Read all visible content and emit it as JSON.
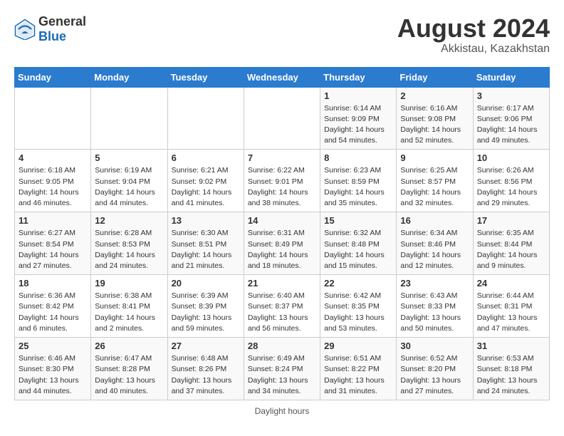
{
  "header": {
    "logo_general": "General",
    "logo_blue": "Blue",
    "month_year": "August 2024",
    "location": "Akkistau, Kazakhstan"
  },
  "days_of_week": [
    "Sunday",
    "Monday",
    "Tuesday",
    "Wednesday",
    "Thursday",
    "Friday",
    "Saturday"
  ],
  "footer": {
    "note": "Daylight hours"
  },
  "weeks": [
    {
      "days": [
        {
          "num": "",
          "sunrise": "",
          "sunset": "",
          "daylight": ""
        },
        {
          "num": "",
          "sunrise": "",
          "sunset": "",
          "daylight": ""
        },
        {
          "num": "",
          "sunrise": "",
          "sunset": "",
          "daylight": ""
        },
        {
          "num": "",
          "sunrise": "",
          "sunset": "",
          "daylight": ""
        },
        {
          "num": "1",
          "sunrise": "Sunrise: 6:14 AM",
          "sunset": "Sunset: 9:09 PM",
          "daylight": "Daylight: 14 hours and 54 minutes."
        },
        {
          "num": "2",
          "sunrise": "Sunrise: 6:16 AM",
          "sunset": "Sunset: 9:08 PM",
          "daylight": "Daylight: 14 hours and 52 minutes."
        },
        {
          "num": "3",
          "sunrise": "Sunrise: 6:17 AM",
          "sunset": "Sunset: 9:06 PM",
          "daylight": "Daylight: 14 hours and 49 minutes."
        }
      ]
    },
    {
      "days": [
        {
          "num": "4",
          "sunrise": "Sunrise: 6:18 AM",
          "sunset": "Sunset: 9:05 PM",
          "daylight": "Daylight: 14 hours and 46 minutes."
        },
        {
          "num": "5",
          "sunrise": "Sunrise: 6:19 AM",
          "sunset": "Sunset: 9:04 PM",
          "daylight": "Daylight: 14 hours and 44 minutes."
        },
        {
          "num": "6",
          "sunrise": "Sunrise: 6:21 AM",
          "sunset": "Sunset: 9:02 PM",
          "daylight": "Daylight: 14 hours and 41 minutes."
        },
        {
          "num": "7",
          "sunrise": "Sunrise: 6:22 AM",
          "sunset": "Sunset: 9:01 PM",
          "daylight": "Daylight: 14 hours and 38 minutes."
        },
        {
          "num": "8",
          "sunrise": "Sunrise: 6:23 AM",
          "sunset": "Sunset: 8:59 PM",
          "daylight": "Daylight: 14 hours and 35 minutes."
        },
        {
          "num": "9",
          "sunrise": "Sunrise: 6:25 AM",
          "sunset": "Sunset: 8:57 PM",
          "daylight": "Daylight: 14 hours and 32 minutes."
        },
        {
          "num": "10",
          "sunrise": "Sunrise: 6:26 AM",
          "sunset": "Sunset: 8:56 PM",
          "daylight": "Daylight: 14 hours and 29 minutes."
        }
      ]
    },
    {
      "days": [
        {
          "num": "11",
          "sunrise": "Sunrise: 6:27 AM",
          "sunset": "Sunset: 8:54 PM",
          "daylight": "Daylight: 14 hours and 27 minutes."
        },
        {
          "num": "12",
          "sunrise": "Sunrise: 6:28 AM",
          "sunset": "Sunset: 8:53 PM",
          "daylight": "Daylight: 14 hours and 24 minutes."
        },
        {
          "num": "13",
          "sunrise": "Sunrise: 6:30 AM",
          "sunset": "Sunset: 8:51 PM",
          "daylight": "Daylight: 14 hours and 21 minutes."
        },
        {
          "num": "14",
          "sunrise": "Sunrise: 6:31 AM",
          "sunset": "Sunset: 8:49 PM",
          "daylight": "Daylight: 14 hours and 18 minutes."
        },
        {
          "num": "15",
          "sunrise": "Sunrise: 6:32 AM",
          "sunset": "Sunset: 8:48 PM",
          "daylight": "Daylight: 14 hours and 15 minutes."
        },
        {
          "num": "16",
          "sunrise": "Sunrise: 6:34 AM",
          "sunset": "Sunset: 8:46 PM",
          "daylight": "Daylight: 14 hours and 12 minutes."
        },
        {
          "num": "17",
          "sunrise": "Sunrise: 6:35 AM",
          "sunset": "Sunset: 8:44 PM",
          "daylight": "Daylight: 14 hours and 9 minutes."
        }
      ]
    },
    {
      "days": [
        {
          "num": "18",
          "sunrise": "Sunrise: 6:36 AM",
          "sunset": "Sunset: 8:42 PM",
          "daylight": "Daylight: 14 hours and 6 minutes."
        },
        {
          "num": "19",
          "sunrise": "Sunrise: 6:38 AM",
          "sunset": "Sunset: 8:41 PM",
          "daylight": "Daylight: 14 hours and 2 minutes."
        },
        {
          "num": "20",
          "sunrise": "Sunrise: 6:39 AM",
          "sunset": "Sunset: 8:39 PM",
          "daylight": "Daylight: 13 hours and 59 minutes."
        },
        {
          "num": "21",
          "sunrise": "Sunrise: 6:40 AM",
          "sunset": "Sunset: 8:37 PM",
          "daylight": "Daylight: 13 hours and 56 minutes."
        },
        {
          "num": "22",
          "sunrise": "Sunrise: 6:42 AM",
          "sunset": "Sunset: 8:35 PM",
          "daylight": "Daylight: 13 hours and 53 minutes."
        },
        {
          "num": "23",
          "sunrise": "Sunrise: 6:43 AM",
          "sunset": "Sunset: 8:33 PM",
          "daylight": "Daylight: 13 hours and 50 minutes."
        },
        {
          "num": "24",
          "sunrise": "Sunrise: 6:44 AM",
          "sunset": "Sunset: 8:31 PM",
          "daylight": "Daylight: 13 hours and 47 minutes."
        }
      ]
    },
    {
      "days": [
        {
          "num": "25",
          "sunrise": "Sunrise: 6:46 AM",
          "sunset": "Sunset: 8:30 PM",
          "daylight": "Daylight: 13 hours and 44 minutes."
        },
        {
          "num": "26",
          "sunrise": "Sunrise: 6:47 AM",
          "sunset": "Sunset: 8:28 PM",
          "daylight": "Daylight: 13 hours and 40 minutes."
        },
        {
          "num": "27",
          "sunrise": "Sunrise: 6:48 AM",
          "sunset": "Sunset: 8:26 PM",
          "daylight": "Daylight: 13 hours and 37 minutes."
        },
        {
          "num": "28",
          "sunrise": "Sunrise: 6:49 AM",
          "sunset": "Sunset: 8:24 PM",
          "daylight": "Daylight: 13 hours and 34 minutes."
        },
        {
          "num": "29",
          "sunrise": "Sunrise: 6:51 AM",
          "sunset": "Sunset: 8:22 PM",
          "daylight": "Daylight: 13 hours and 31 minutes."
        },
        {
          "num": "30",
          "sunrise": "Sunrise: 6:52 AM",
          "sunset": "Sunset: 8:20 PM",
          "daylight": "Daylight: 13 hours and 27 minutes."
        },
        {
          "num": "31",
          "sunrise": "Sunrise: 6:53 AM",
          "sunset": "Sunset: 8:18 PM",
          "daylight": "Daylight: 13 hours and 24 minutes."
        }
      ]
    }
  ]
}
